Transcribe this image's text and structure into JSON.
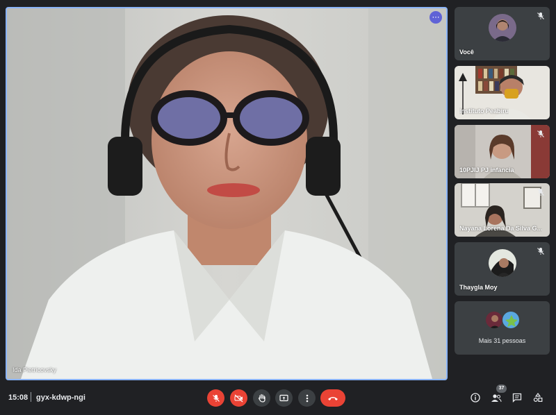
{
  "main_speaker": {
    "name": "Ida Pietricovsky",
    "menu_glyph": "⋯",
    "highlight_color": "#8ab4f8"
  },
  "participants": [
    {
      "name": "Você",
      "muted": true,
      "avatar": "photo"
    },
    {
      "name": "Instituto Peabiru",
      "muted": false,
      "avatar": "video"
    },
    {
      "name": "10PJIJ PJ infancia",
      "muted": true,
      "avatar": "video"
    },
    {
      "name": "Nayana Lorena Da Silva G...",
      "muted": true,
      "avatar": "video"
    },
    {
      "name": "Thaygla Moy",
      "muted": true,
      "avatar": "photo"
    }
  ],
  "more": {
    "label": "Mais 31 pessoas"
  },
  "bottom_bar": {
    "time": "15:08",
    "meeting_code": "gyx-kdwp-ngi",
    "controls": [
      "mic-off-button",
      "camera-off-button",
      "raise-hand-button",
      "present-button",
      "more-options-button",
      "leave-call-button"
    ],
    "people_count": "37"
  },
  "colors": {
    "background": "#202124",
    "tile": "#3c4043",
    "danger": "#ea4335",
    "accent": "#8ab4f8"
  }
}
